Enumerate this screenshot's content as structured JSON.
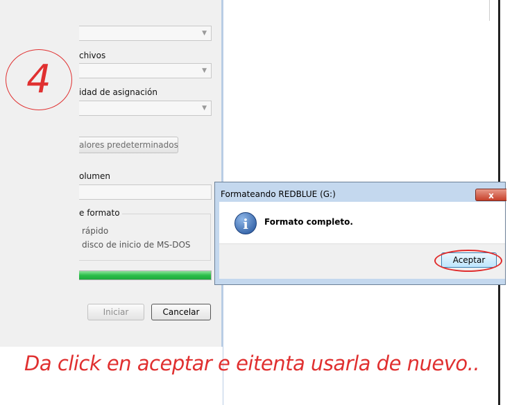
{
  "step": {
    "number": "4"
  },
  "format_dialog": {
    "label_file_system": "chivos",
    "label_allocation_unit": "idad de asignación",
    "restore_defaults_label": "alores predeterminados",
    "label_volume": "olumen",
    "group_format_options": "e formato",
    "option_quick": "rápido",
    "option_msdos": "disco de inicio de MS-DOS",
    "progress": 1.0,
    "start_label": "Iniciar",
    "cancel_label": "Cancelar"
  },
  "message_box": {
    "title": "Formateando REDBLUE (G:)",
    "message": "Formato completo.",
    "ok_label": "Aceptar",
    "close_label": "x",
    "icon": "info-icon"
  },
  "caption": "Da click en aceptar e eitenta usarla de nuevo..",
  "colors": {
    "annotation": "#e03030",
    "progress": "#2bbf4a"
  }
}
